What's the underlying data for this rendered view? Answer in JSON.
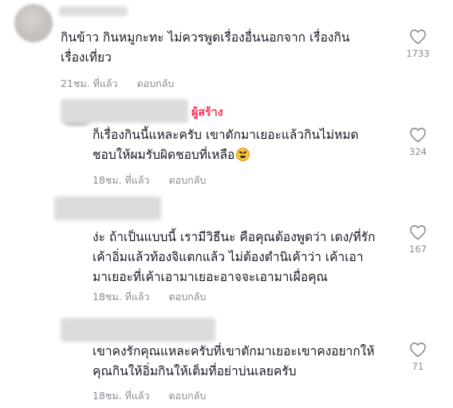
{
  "comments": [
    {
      "text": "กินข้าว กินหมูกะทะ ไม่ควรพูดเรื่องอื่นนอกจาก เรื่องกิน\nเรื่องเที่ยว",
      "time": "21ชม. ที่แล้ว",
      "reply_label": "ตอบกลับ",
      "likes": "1733"
    },
    {
      "creator_badge": "ผู้สร้าง",
      "text": "ก็เรื่องกินนี้แหละครับ เขาตักมาเยอะแล้วกินไม่หมด\nชอบให้ผมรับผิดชอบที่เหลือ",
      "emoji": "tired-face-emoji",
      "time": "18ชม. ที่แล้ว",
      "reply_label": "ตอบกลับ",
      "likes": "324"
    },
    {
      "text": "ง่ะ ถ้าเป็นแบบนี้ เรามีวิธีนะ คือคุณต้องพูดว่า เตง/ที่รัก\nเค้าอิ่มแล้วท้องจิแตกแล้ว ไม่ต้องตำนิเค้าว่า เค้าเอา\nมาเยอะที่เค้าเอามาเยอะอาจจะเอามาเผื่อคุณ",
      "time": "18ชม. ที่แล้ว",
      "reply_label": "ตอบกลับ",
      "likes": "167"
    },
    {
      "text": "เขาคงรักคุณแหละครับที่เขาตักมาเยอะเขาคงอยากให้\nคุณกินให้อิ่มกินให้เต็มที่อย่าบ่นเลยครับ",
      "time": "18ชม. ที่แล้ว",
      "reply_label": "ตอบกลับ",
      "likes": "71"
    }
  ],
  "icons": {
    "like": "heart-outline-icon"
  },
  "colors": {
    "creator_badge": "#fe2c55",
    "meta_text": "#8a8b91",
    "body_text": "#161823"
  }
}
